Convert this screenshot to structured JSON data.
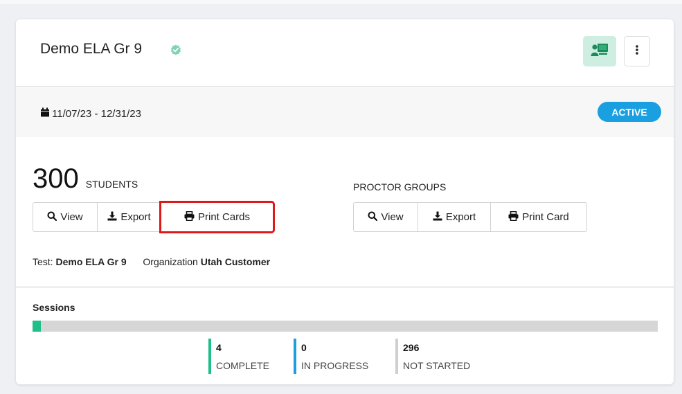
{
  "header": {
    "title": "Demo ELA Gr 9",
    "verified_icon": "verified-check-icon",
    "classroom_icon": "proctor-classroom-icon",
    "kebab_icon": "vertical-ellipsis-icon"
  },
  "date_row": {
    "date_range": "11/07/23 - 12/31/23",
    "status": "ACTIVE"
  },
  "students": {
    "count": "300",
    "label": "STUDENTS",
    "buttons": {
      "view": "View",
      "export": "Export",
      "print": "Print Cards"
    }
  },
  "proctor_groups": {
    "label": "PROCTOR GROUPS",
    "buttons": {
      "view": "View",
      "export": "Export",
      "print": "Print Card"
    }
  },
  "meta": {
    "test_label": "Test:",
    "test_value": "Demo ELA Gr 9",
    "org_label": "Organization",
    "org_value": "Utah Customer"
  },
  "sessions": {
    "label": "Sessions",
    "progress_fraction": 0.0133,
    "stats": [
      {
        "count": "4",
        "label": "COMPLETE",
        "color": "#1fbf8a"
      },
      {
        "count": "0",
        "label": "IN PROGRESS",
        "color": "#1a9fe0"
      },
      {
        "count": "296",
        "label": "NOT STARTED",
        "color": "#cfcfcf"
      }
    ]
  },
  "colors": {
    "accent_green": "#1fbf8a",
    "accent_blue": "#1a9fe0",
    "highlight_red": "#e01818"
  }
}
